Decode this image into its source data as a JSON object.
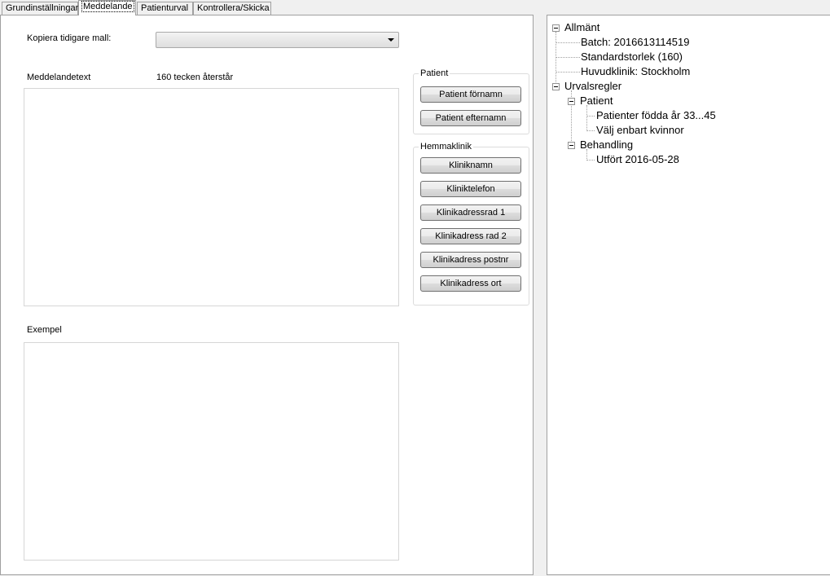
{
  "tabs": [
    {
      "label": "Grundinställningar"
    },
    {
      "label": "Meddelande"
    },
    {
      "label": "Patienturval"
    },
    {
      "label": "Kontrollera/Skicka"
    }
  ],
  "form": {
    "copy_template_label": "Kopiera tidigare mall:",
    "copy_template_value": "",
    "message_label": "Meddelandetext",
    "chars_remaining": "160 tecken återstår",
    "message_text": "",
    "example_label": "Exempel",
    "example_text": ""
  },
  "patient_group": {
    "title": "Patient",
    "buttons": [
      "Patient förnamn",
      "Patient efternamn"
    ]
  },
  "clinic_group": {
    "title": "Hemmaklinik",
    "buttons": [
      "Kliniknamn",
      "Kliniktelefon",
      "Klinikadressrad 1",
      "Klinikadress rad 2",
      "Klinikadress postnr",
      "Klinikadress ort"
    ]
  },
  "tree": {
    "general": {
      "label": "Allmänt",
      "children": [
        "Batch: 2016613114519",
        "Standardstorlek (160)",
        "Huvudklinik: Stockholm"
      ]
    },
    "rules": {
      "label": "Urvalsregler",
      "patient": {
        "label": "Patient",
        "children": [
          "Patienter födda år  33...45",
          "Välj enbart kvinnor"
        ]
      },
      "treatment": {
        "label": "Behandling",
        "children": [
          "Utfört  2016-05-28"
        ]
      }
    }
  }
}
